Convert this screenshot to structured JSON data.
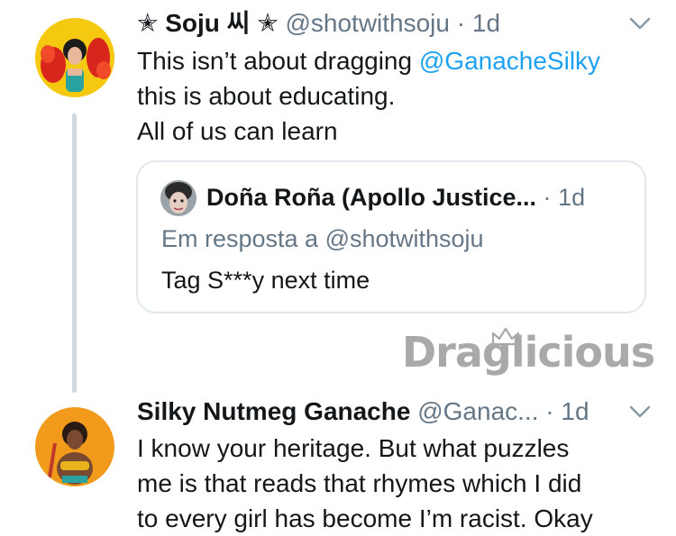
{
  "tweet1": {
    "display_name": "✭ Soju 씨 ✭",
    "handle": "@shotwithsoju",
    "separator": "·",
    "time": "1d",
    "text_before_mention": "This isn’t about dragging ",
    "mention": "@GanacheSilky",
    "line2": "this is about educating.",
    "line3": "All of us can learn",
    "menu_icon": "chevron-down-icon"
  },
  "quote": {
    "display_name": "Doña Roña (Apollo Justice...",
    "separator": "·",
    "time": "1d",
    "reply_to": "Em resposta a @shotwithsoju",
    "text": "Tag S***y next time"
  },
  "watermark": {
    "text": "Draglicious",
    "icon": "crown-icon"
  },
  "tweet2": {
    "display_name": "Silky Nutmeg Ganache",
    "handle": "@Ganac...",
    "separator": "·",
    "time": "1d",
    "line1": "I know your heritage. But what puzzles",
    "line2": "me is that reads that rhymes which I did",
    "line3": "to every girl has become I’m racist. Okay",
    "menu_icon": "chevron-down-icon"
  },
  "colors": {
    "link": "#1da1f2",
    "meta": "#657786",
    "text": "#14171a",
    "border": "#e1e8ed",
    "thread_line": "#cfd9de"
  }
}
